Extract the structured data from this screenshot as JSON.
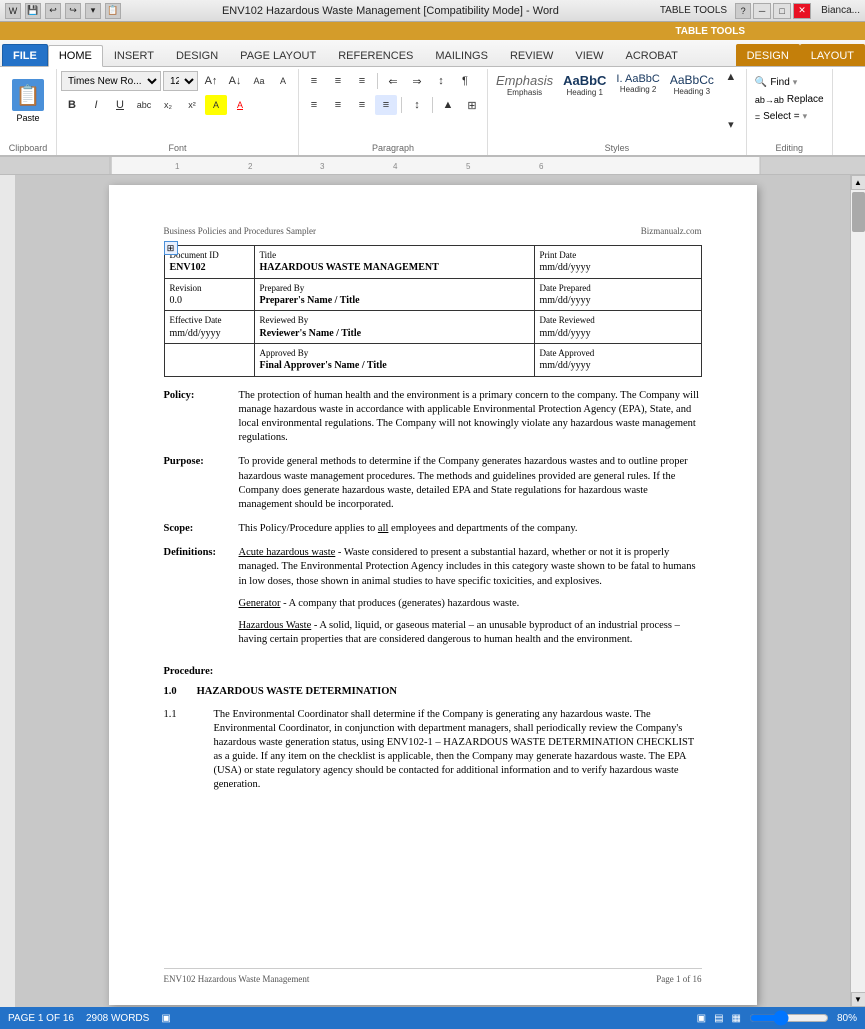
{
  "titlebar": {
    "title": "ENV102 Hazardous Waste Management [Compatibility Mode] - Word",
    "table_tools_label": "TABLE TOOLS",
    "app_name": "Word",
    "user": "Bianca...",
    "min_btn": "─",
    "max_btn": "□",
    "close_btn": "✕"
  },
  "ribbon_tabs": {
    "file": "FILE",
    "home": "HOME",
    "insert": "INSERT",
    "design": "DESIGN",
    "page_layout": "PAGE LAYOUT",
    "references": "REFERENCES",
    "mailings": "MAILINGS",
    "review": "REVIEW",
    "view": "VIEW",
    "acrobat": "ACROBAT",
    "table_tools_design": "DESIGN",
    "table_tools_layout": "LAYOUT"
  },
  "ribbon": {
    "clipboard": {
      "label": "Clipboard",
      "paste_label": "Paste"
    },
    "font": {
      "label": "Font",
      "name": "Times New Ro...",
      "size": "12",
      "bold": "B",
      "italic": "I",
      "underline": "U",
      "strikethrough": "abc",
      "subscript": "x₂",
      "superscript": "x²",
      "grow": "A",
      "shrink": "A",
      "case": "Aa",
      "clear": "A",
      "highlight": "A",
      "color": "A"
    },
    "paragraph": {
      "label": "Paragraph",
      "bullets": "≡",
      "numbering": "≡",
      "multilevel": "≡",
      "decrease": "⇐",
      "increase": "⇒",
      "sort": "↕",
      "show_para": "¶",
      "align_left": "≡",
      "align_center": "≡",
      "align_right": "≡",
      "justify": "≡",
      "line_spacing": "↕",
      "shading": "▲",
      "borders": "⊞"
    },
    "styles": {
      "label": "Styles",
      "emphasis": "Emphasis",
      "heading1": "AaBbC",
      "heading2": "I. AaBbC",
      "heading3": "AaBbCc",
      "emphasis_label": "Emphasis",
      "heading1_label": "Heading 1",
      "heading2_label": "Heading 2",
      "heading3_label": "Heading 3"
    },
    "editing": {
      "label": "Editing",
      "find": "Find",
      "replace": "Replace",
      "select": "Select ="
    }
  },
  "document": {
    "header_left": "Business Policies and Procedures Sampler",
    "header_right": "Bizmanualz.com",
    "table": {
      "rows": [
        [
          {
            "label": "Document ID",
            "value": "ENV102",
            "bold_value": true
          },
          {
            "label": "Title",
            "value": "HAZARDOUS WASTE MANAGEMENT",
            "bold_value": true
          },
          {
            "label": "Print Date",
            "value": "mm/dd/yyyy"
          }
        ],
        [
          {
            "label": "Revision",
            "value": "0.0",
            "bold_value": false
          },
          {
            "label": "Prepared By",
            "value": "Preparer's Name / Title",
            "bold_value": true
          },
          {
            "label": "Date Prepared",
            "value": "mm/dd/yyyy"
          }
        ],
        [
          {
            "label": "Effective Date",
            "value": "mm/dd/yyyy",
            "bold_value": false
          },
          {
            "label": "Reviewed By",
            "value": "Reviewer's Name / Title",
            "bold_value": true
          },
          {
            "label": "Date Reviewed",
            "value": "mm/dd/yyyy"
          }
        ],
        [
          {
            "label": "",
            "value": ""
          },
          {
            "label": "Approved By",
            "value": "Final Approver's Name / Title",
            "bold_value": true
          },
          {
            "label": "Date Approved",
            "value": "mm/dd/yyyy"
          }
        ]
      ]
    },
    "sections": [
      {
        "label": "Policy:",
        "text": "The protection of human health and the environment is a primary concern to the company.  The Company will manage hazardous waste in accordance with applicable Environmental Protection Agency (EPA), State, and local environmental regulations.  The Company will not knowingly violate any hazardous waste management regulations."
      },
      {
        "label": "Purpose:",
        "text": "To provide general methods to determine if the Company generates hazardous wastes and to outline proper hazardous waste management procedures.  The methods and guidelines provided are general rules.  If the Company does generate hazardous waste, detailed EPA and State regulations for hazardous waste management should be incorporated."
      },
      {
        "label": "Scope:",
        "text": "This Policy/Procedure applies to all employees and departments of the company."
      },
      {
        "label": "Definitions:",
        "definitions": [
          {
            "term": "Acute hazardous waste",
            "underline": true,
            "text": " - Waste considered to present a substantial hazard, whether or not it is properly managed.  The Environmental Protection Agency includes in this category waste shown to be fatal to humans in low doses, those shown in animal studies to have specific toxicities, and explosives."
          },
          {
            "term": "Generator",
            "underline": true,
            "text": " - A company that produces (generates) hazardous waste."
          },
          {
            "term": "Hazardous Waste",
            "underline": true,
            "text": " - A solid, liquid, or gaseous material – an unusable byproduct of an industrial process – having certain properties that are considered dangerous to human health and the environment."
          }
        ]
      }
    ],
    "procedure_label": "Procedure:",
    "section1": {
      "number": "1.0",
      "title": "HAZARDOUS WASTE DETERMINATION",
      "subsections": [
        {
          "number": "1.1",
          "text": "The Environmental Coordinator shall determine if the Company is generating any hazardous waste.  The Environmental Coordinator, in conjunction with department managers, shall periodically review the Company's hazardous waste generation status, using ENV102-1 – HAZARDOUS WASTE DETERMINATION CHECKLIST as a guide.  If any item on the checklist is applicable, then the Company may generate hazardous waste.  The EPA (USA) or state regulatory agency should be contacted for additional information and to verify hazardous waste generation."
        }
      ]
    },
    "footer_left": "ENV102 Hazardous Waste Management",
    "footer_center": "Page 1 of 16"
  },
  "statusbar": {
    "page_info": "PAGE 1 OF 16",
    "word_count": "2908 WORDS",
    "zoom": "80%",
    "view_icons": [
      "▣",
      "▤",
      "▦"
    ]
  }
}
